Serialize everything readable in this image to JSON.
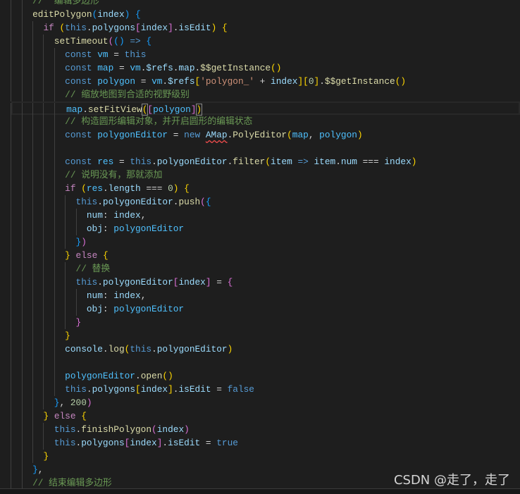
{
  "editor": {
    "current_line": 8,
    "lines": [
      {
        "indent": 6,
        "t": [
          [
            "//  编辑多边形",
            "cmt"
          ]
        ]
      },
      {
        "indent": 6,
        "t": [
          [
            "editPolygon",
            "fn"
          ],
          [
            "(",
            "b3"
          ],
          [
            "index",
            "var"
          ],
          [
            ")",
            "b3"
          ],
          [
            " ",
            "pun"
          ],
          [
            "{",
            "b3"
          ]
        ]
      },
      {
        "indent": 8,
        "t": [
          [
            "if",
            "ctl"
          ],
          [
            " ",
            "pun"
          ],
          [
            "(",
            "b1"
          ],
          [
            "this",
            "kw"
          ],
          [
            ".",
            "pun"
          ],
          [
            "polygons",
            "var"
          ],
          [
            "[",
            "b2"
          ],
          [
            "index",
            "var"
          ],
          [
            "]",
            "b2"
          ],
          [
            ".",
            "pun"
          ],
          [
            "isEdit",
            "var"
          ],
          [
            ")",
            "b1"
          ],
          [
            " ",
            "pun"
          ],
          [
            "{",
            "b1"
          ]
        ]
      },
      {
        "indent": 10,
        "t": [
          [
            "setTimeout",
            "fn"
          ],
          [
            "(",
            "b2"
          ],
          [
            "()",
            "b3"
          ],
          [
            " ",
            "pun"
          ],
          [
            "=>",
            "kw"
          ],
          [
            " ",
            "pun"
          ],
          [
            "{",
            "b3"
          ]
        ]
      },
      {
        "indent": 12,
        "t": [
          [
            "const",
            "kw"
          ],
          [
            " ",
            "pun"
          ],
          [
            "vm",
            "cst"
          ],
          [
            " = ",
            "pun"
          ],
          [
            "this",
            "kw"
          ]
        ]
      },
      {
        "indent": 12,
        "t": [
          [
            "const",
            "kw"
          ],
          [
            " ",
            "pun"
          ],
          [
            "map",
            "cst"
          ],
          [
            " = ",
            "pun"
          ],
          [
            "vm",
            "cst"
          ],
          [
            ".",
            "pun"
          ],
          [
            "$refs",
            "var"
          ],
          [
            ".",
            "pun"
          ],
          [
            "map",
            "var"
          ],
          [
            ".",
            "pun"
          ],
          [
            "$$getInstance",
            "fn"
          ],
          [
            "()",
            "b1"
          ]
        ]
      },
      {
        "indent": 12,
        "t": [
          [
            "const",
            "kw"
          ],
          [
            " ",
            "pun"
          ],
          [
            "polygon",
            "cst"
          ],
          [
            " = ",
            "pun"
          ],
          [
            "vm",
            "cst"
          ],
          [
            ".",
            "pun"
          ],
          [
            "$refs",
            "var"
          ],
          [
            "[",
            "b1"
          ],
          [
            "'polygon_'",
            "str"
          ],
          [
            " + ",
            "pun"
          ],
          [
            "index",
            "var"
          ],
          [
            "]",
            "b1"
          ],
          [
            "[",
            "b1"
          ],
          [
            "0",
            "num"
          ],
          [
            "]",
            "b1"
          ],
          [
            ".",
            "pun"
          ],
          [
            "$$getInstance",
            "fn"
          ],
          [
            "()",
            "b1"
          ]
        ]
      },
      {
        "indent": 12,
        "t": [
          [
            "// 缩放地图到合适的视野级别",
            "cmt"
          ]
        ]
      },
      {
        "indent": 12,
        "t": [
          [
            "map",
            "cst"
          ],
          [
            ".",
            "pun"
          ],
          [
            "setFitView",
            "fn"
          ],
          [
            "(",
            "b1 match"
          ],
          [
            "[",
            "b2"
          ],
          [
            "polygon",
            "cst"
          ],
          [
            "]",
            "b2"
          ],
          [
            ")",
            "b1 match"
          ]
        ]
      },
      {
        "indent": 12,
        "t": [
          [
            "// 构造圆形编辑对象，并开启圆形的编辑状态",
            "cmt"
          ]
        ]
      },
      {
        "indent": 12,
        "t": [
          [
            "const",
            "kw"
          ],
          [
            " ",
            "pun"
          ],
          [
            "polygonEditor",
            "cst"
          ],
          [
            " = ",
            "pun"
          ],
          [
            "new",
            "kw"
          ],
          [
            " ",
            "pun"
          ],
          [
            "AMap",
            "var err"
          ],
          [
            ".",
            "pun"
          ],
          [
            "PolyEditor",
            "fn"
          ],
          [
            "(",
            "b1"
          ],
          [
            "map",
            "cst"
          ],
          [
            ", ",
            "pun"
          ],
          [
            "polygon",
            "cst"
          ],
          [
            ")",
            "b1"
          ]
        ]
      },
      {
        "indent": 12,
        "t": []
      },
      {
        "indent": 12,
        "t": [
          [
            "const",
            "kw"
          ],
          [
            " ",
            "pun"
          ],
          [
            "res",
            "cst"
          ],
          [
            " = ",
            "pun"
          ],
          [
            "this",
            "kw"
          ],
          [
            ".",
            "pun"
          ],
          [
            "polygonEditor",
            "var"
          ],
          [
            ".",
            "pun"
          ],
          [
            "filter",
            "fn"
          ],
          [
            "(",
            "b1"
          ],
          [
            "item",
            "var"
          ],
          [
            " ",
            "pun"
          ],
          [
            "=>",
            "kw"
          ],
          [
            " ",
            "pun"
          ],
          [
            "item",
            "var"
          ],
          [
            ".",
            "pun"
          ],
          [
            "num",
            "var"
          ],
          [
            " === ",
            "pun"
          ],
          [
            "index",
            "var"
          ],
          [
            ")",
            "b1"
          ]
        ]
      },
      {
        "indent": 12,
        "t": [
          [
            "// 说明没有，那就添加",
            "cmt"
          ]
        ]
      },
      {
        "indent": 12,
        "t": [
          [
            "if",
            "ctl"
          ],
          [
            " ",
            "pun"
          ],
          [
            "(",
            "b1"
          ],
          [
            "res",
            "cst"
          ],
          [
            ".",
            "pun"
          ],
          [
            "length",
            "var"
          ],
          [
            " === ",
            "pun"
          ],
          [
            "0",
            "num"
          ],
          [
            ")",
            "b1"
          ],
          [
            " ",
            "pun"
          ],
          [
            "{",
            "b1"
          ]
        ]
      },
      {
        "indent": 14,
        "t": [
          [
            "this",
            "kw"
          ],
          [
            ".",
            "pun"
          ],
          [
            "polygonEditor",
            "var"
          ],
          [
            ".",
            "pun"
          ],
          [
            "push",
            "fn"
          ],
          [
            "(",
            "b2"
          ],
          [
            "{",
            "b3"
          ]
        ]
      },
      {
        "indent": 16,
        "t": [
          [
            "num",
            "var"
          ],
          [
            ": ",
            "pun"
          ],
          [
            "index",
            "var"
          ],
          [
            ",",
            "pun"
          ]
        ]
      },
      {
        "indent": 16,
        "t": [
          [
            "obj",
            "var"
          ],
          [
            ": ",
            "pun"
          ],
          [
            "polygonEditor",
            "cst"
          ]
        ]
      },
      {
        "indent": 14,
        "t": [
          [
            "}",
            "b3"
          ],
          [
            ")",
            "b2"
          ]
        ]
      },
      {
        "indent": 12,
        "t": [
          [
            "}",
            "b1"
          ],
          [
            " ",
            "pun"
          ],
          [
            "else",
            "ctl"
          ],
          [
            " ",
            "pun"
          ],
          [
            "{",
            "b1"
          ]
        ]
      },
      {
        "indent": 14,
        "t": [
          [
            "// 替换",
            "cmt"
          ]
        ]
      },
      {
        "indent": 14,
        "t": [
          [
            "this",
            "kw"
          ],
          [
            ".",
            "pun"
          ],
          [
            "polygonEditor",
            "var"
          ],
          [
            "[",
            "b2"
          ],
          [
            "index",
            "var"
          ],
          [
            "]",
            "b2"
          ],
          [
            " = ",
            "pun"
          ],
          [
            "{",
            "b2"
          ]
        ]
      },
      {
        "indent": 16,
        "t": [
          [
            "num",
            "var"
          ],
          [
            ": ",
            "pun"
          ],
          [
            "index",
            "var"
          ],
          [
            ",",
            "pun"
          ]
        ]
      },
      {
        "indent": 16,
        "t": [
          [
            "obj",
            "var"
          ],
          [
            ": ",
            "pun"
          ],
          [
            "polygonEditor",
            "cst"
          ]
        ]
      },
      {
        "indent": 14,
        "t": [
          [
            "}",
            "b2"
          ]
        ]
      },
      {
        "indent": 12,
        "t": [
          [
            "}",
            "b1"
          ]
        ]
      },
      {
        "indent": 12,
        "t": [
          [
            "console",
            "var"
          ],
          [
            ".",
            "pun"
          ],
          [
            "log",
            "fn"
          ],
          [
            "(",
            "b1"
          ],
          [
            "this",
            "kw"
          ],
          [
            ".",
            "pun"
          ],
          [
            "polygonEditor",
            "var"
          ],
          [
            ")",
            "b1"
          ]
        ]
      },
      {
        "indent": 12,
        "t": []
      },
      {
        "indent": 12,
        "t": [
          [
            "polygonEditor",
            "cst"
          ],
          [
            ".",
            "pun"
          ],
          [
            "open",
            "fn"
          ],
          [
            "()",
            "b1"
          ]
        ]
      },
      {
        "indent": 12,
        "t": [
          [
            "this",
            "kw"
          ],
          [
            ".",
            "pun"
          ],
          [
            "polygons",
            "var"
          ],
          [
            "[",
            "b1"
          ],
          [
            "index",
            "var"
          ],
          [
            "]",
            "b1"
          ],
          [
            ".",
            "pun"
          ],
          [
            "isEdit",
            "var"
          ],
          [
            " = ",
            "pun"
          ],
          [
            "false",
            "kw"
          ]
        ]
      },
      {
        "indent": 10,
        "t": [
          [
            "}",
            "b3"
          ],
          [
            ", ",
            "pun"
          ],
          [
            "200",
            "num"
          ],
          [
            ")",
            "b2"
          ]
        ]
      },
      {
        "indent": 8,
        "t": [
          [
            "}",
            "b1"
          ],
          [
            " ",
            "pun"
          ],
          [
            "else",
            "ctl"
          ],
          [
            " ",
            "pun"
          ],
          [
            "{",
            "b1"
          ]
        ]
      },
      {
        "indent": 10,
        "t": [
          [
            "this",
            "kw"
          ],
          [
            ".",
            "pun"
          ],
          [
            "finishPolygon",
            "fn"
          ],
          [
            "(",
            "b2"
          ],
          [
            "index",
            "var"
          ],
          [
            ")",
            "b2"
          ]
        ]
      },
      {
        "indent": 10,
        "t": [
          [
            "this",
            "kw"
          ],
          [
            ".",
            "pun"
          ],
          [
            "polygons",
            "var"
          ],
          [
            "[",
            "b2"
          ],
          [
            "index",
            "var"
          ],
          [
            "]",
            "b2"
          ],
          [
            ".",
            "pun"
          ],
          [
            "isEdit",
            "var"
          ],
          [
            " = ",
            "pun"
          ],
          [
            "true",
            "kw"
          ]
        ]
      },
      {
        "indent": 8,
        "t": [
          [
            "}",
            "b1"
          ]
        ]
      },
      {
        "indent": 6,
        "t": [
          [
            "}",
            "b3"
          ],
          [
            ",",
            "pun"
          ]
        ]
      },
      {
        "indent": 6,
        "t": [
          [
            "// 结束编辑多边形",
            "cmt"
          ]
        ]
      }
    ]
  },
  "watermark": "CSDN @走了，走了"
}
